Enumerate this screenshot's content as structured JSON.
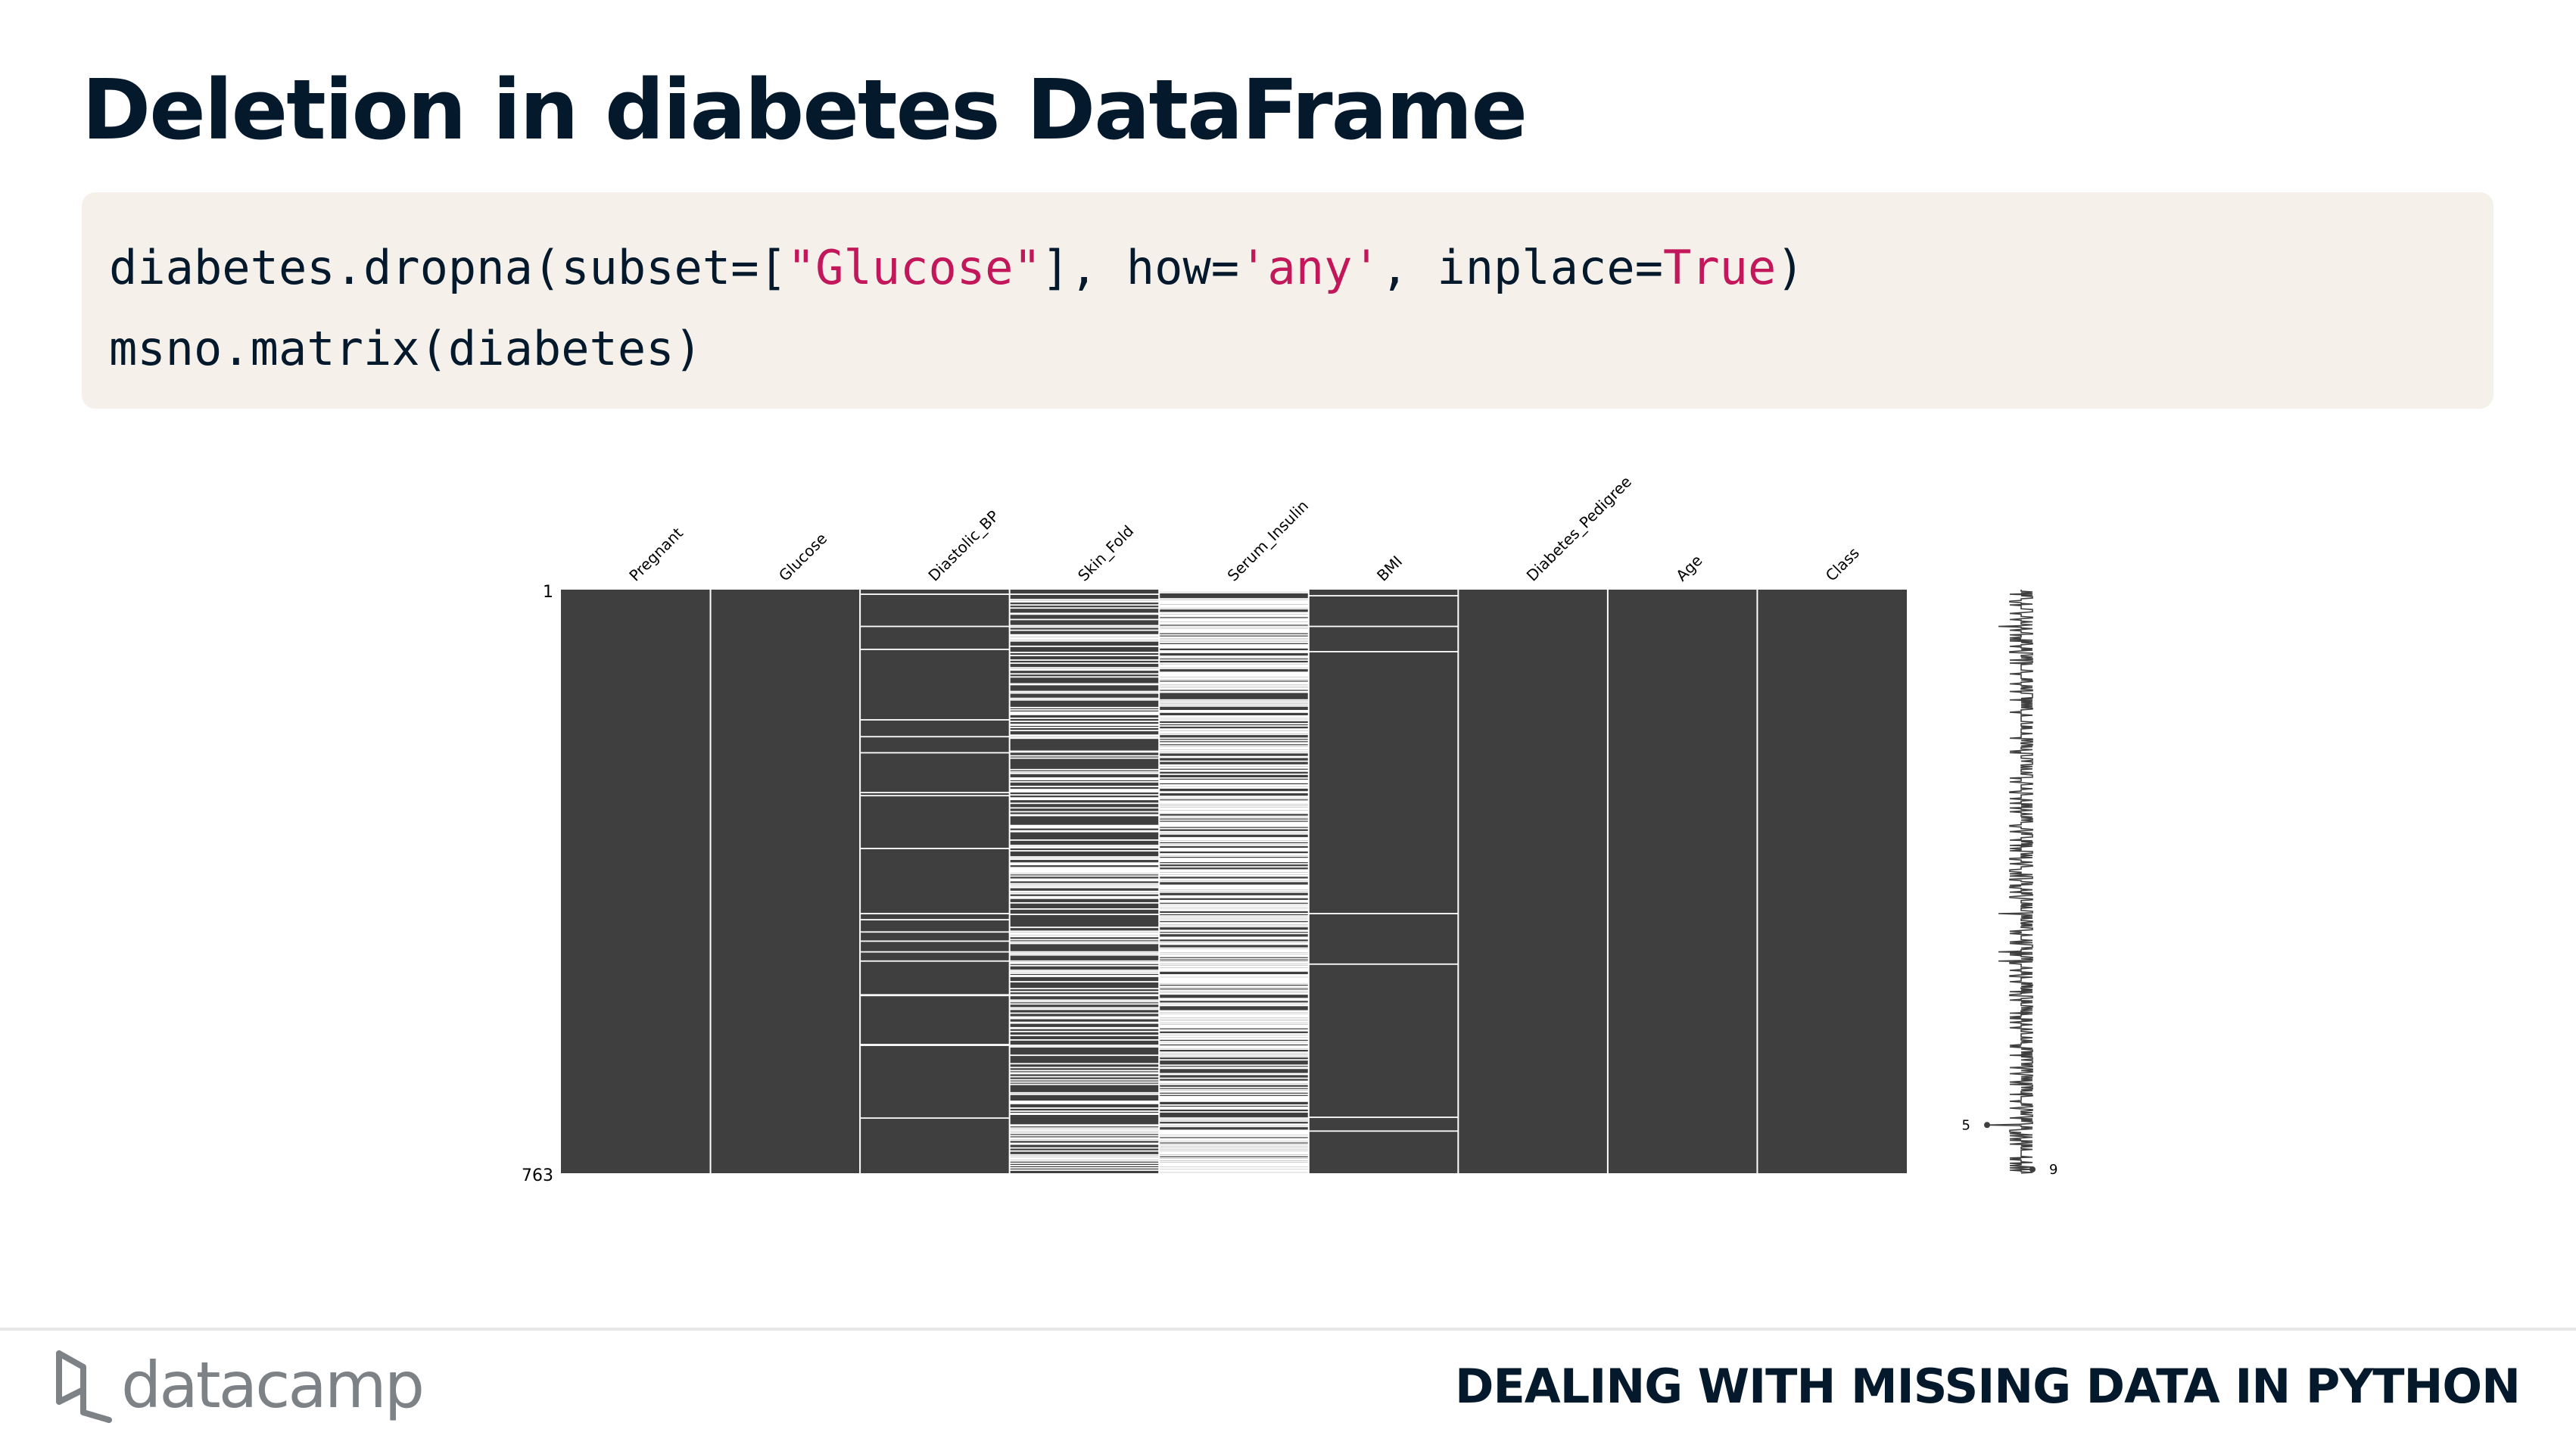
{
  "slide": {
    "title": "Deletion in diabetes DataFrame",
    "footer_course": "DEALING WITH MISSING DATA IN PYTHON",
    "logo_text": "datacamp"
  },
  "code": {
    "lines": [
      [
        {
          "text": "diabetes.dropna(subset=[",
          "kind": "plain"
        },
        {
          "text": "\"Glucose\"",
          "kind": "str"
        },
        {
          "text": "], how=",
          "kind": "plain"
        },
        {
          "text": "'any'",
          "kind": "str"
        },
        {
          "text": ", inplace=",
          "kind": "plain"
        },
        {
          "text": "True",
          "kind": "str"
        },
        {
          "text": ")",
          "kind": "plain"
        }
      ],
      [
        {
          "text": "msno.matrix(diabetes)",
          "kind": "plain"
        }
      ]
    ]
  },
  "colors": {
    "title": "#05192d",
    "code_background": "#f5f1ea",
    "string_token": "#c2185b",
    "matrix_filled": "#3f3f3f",
    "matrix_missing": "#ffffff"
  },
  "chart_data": {
    "type": "heatmap",
    "chart_kind": "missingno matrix",
    "columns": [
      "Pregnant",
      "Glucose",
      "Diastolic_BP",
      "Skin_Fold",
      "Serum_Insulin",
      "BMI",
      "Diabetes_Pedigree",
      "Age",
      "Class"
    ],
    "row_tick_labels": [
      "1",
      "763"
    ],
    "n_rows": 763,
    "missing_fraction": [
      0,
      0,
      0.045,
      0.29,
      0.48,
      0.014,
      0,
      0,
      0
    ],
    "missing_rows": {
      "Pregnant": [],
      "Glucose": [],
      "Diastolic_BP": [
        7,
        49,
        79,
        171,
        193,
        214,
        266,
        270,
        339,
        424,
        432,
        448,
        460,
        474,
        486,
        530,
        531,
        595,
        596,
        691
      ],
      "BMI": [
        9,
        49,
        82,
        424,
        490,
        690,
        708
      ],
      "Age": [],
      "Class": [],
      "Diabetes_Pedigree": []
    },
    "sparkline": {
      "min_label": "5",
      "max_label": "9",
      "min_completeness": 5,
      "max_completeness": 9,
      "min_row": 700,
      "max_row": 758
    }
  }
}
